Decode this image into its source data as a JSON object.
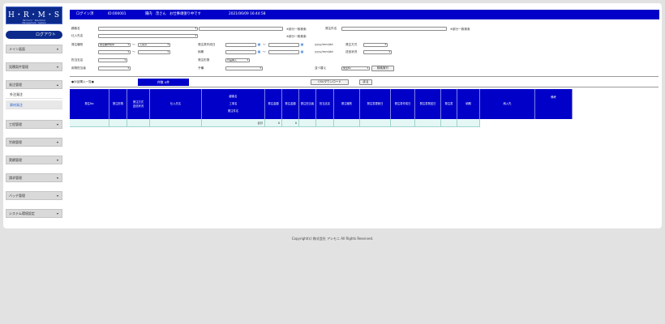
{
  "logo": {
    "title": "H・R・M・S",
    "line1": "Harmonic・Resolution",
    "line2": "Management・System"
  },
  "logout_label": "ログアウト",
  "nav": [
    {
      "label": "メイン画面"
    },
    {
      "label": "見積案件管理"
    },
    {
      "label": "発注管理"
    },
    {
      "label": "工程管理"
    },
    {
      "label": "労務管理"
    },
    {
      "label": "実績管理"
    },
    {
      "label": "請求管理"
    },
    {
      "label": "バッチ管理"
    },
    {
      "label": "システム環境設定"
    }
  ],
  "nav_sub": [
    {
      "label": "外注発注"
    },
    {
      "label": "資材発注"
    }
  ],
  "topbar": {
    "login_label": "ログイン済",
    "id": "ID:000001",
    "user": "陽内　茂さん　お仕事頑張り中です",
    "datetime": "2021/06/09 16:44:58"
  },
  "search": {
    "customer_label": "顧客名",
    "partial_label1": "※部分一致検索",
    "order_name_label": "発注件名",
    "partial_label2": "※部分一致検索",
    "supplier_label": "仕入先名",
    "partial_label3": "※部分一致検索",
    "order_type_label": "発注種別",
    "order_type_value": "発注書作成中",
    "tilde": "〜",
    "order_type_value2": "入荷済",
    "created_label": "発注書作成日",
    "date_placeholder": "yyyy/mm/dd",
    "method_label": "発注方式",
    "deadline_label": "納期",
    "status_label": "送信状況",
    "charge_label": "担当支店",
    "order_form_label": "発注形態",
    "order_form_value": "付品購入",
    "manager_label": "用物担当者",
    "budget_label": "予備",
    "sort_label": "並べ替え",
    "sort_value": "発注No",
    "search_button": "検索実行"
  },
  "list": {
    "title": "●対品購入一覧●",
    "count": "件数 0件",
    "csv_button": "CSVダウンロード",
    "back_button": "戻る"
  },
  "table": {
    "headers": [
      [
        "発注No"
      ],
      [
        "発注形態"
      ],
      [
        "発注方式",
        "送信状況"
      ],
      [
        "仕入先名"
      ],
      [
        "顧客名",
        "",
        "工事名",
        "",
        "発注件名"
      ],
      [
        "発注金額"
      ],
      [
        "発注金額"
      ],
      [
        "発注担当者"
      ],
      [
        "担当支店"
      ],
      [
        "発注種別"
      ],
      [
        "発注書更新日"
      ],
      [
        "発注書作成日"
      ],
      [
        "発注書発送日"
      ],
      [
        "発注書"
      ],
      [
        "納期"
      ],
      [
        "納入先"
      ],
      [
        "備考"
      ]
    ],
    "total_label": "合計",
    "total1": "0",
    "total2": "0"
  },
  "copyright": "Copyright(c) 株式会社 アシモニ All Rights Reserved."
}
